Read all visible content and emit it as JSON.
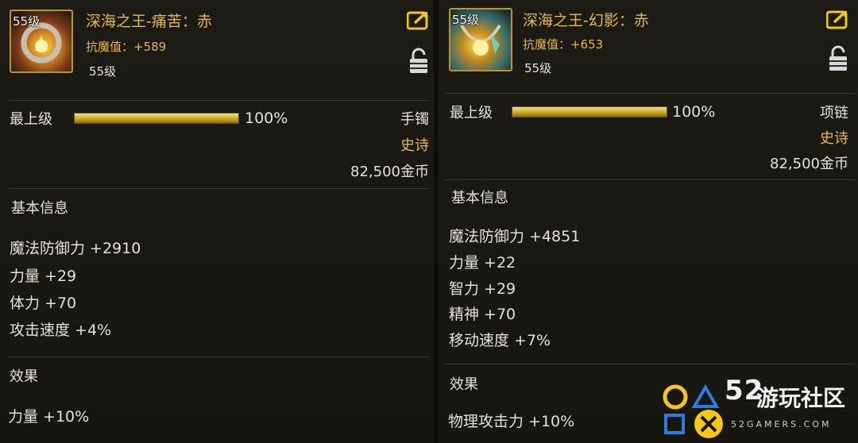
{
  "left": {
    "icon_level": "55级",
    "title": "深海之王-痛苦：赤",
    "resist": "抗魔值：+589",
    "level": "55级",
    "grade_label": "最上级",
    "grade_pct": "100%",
    "grade_fraction": 1.0,
    "slot": "手镯",
    "rarity": "史诗",
    "price": "82,500金币",
    "basic_header": "基本信息",
    "stats": [
      "魔法防御力 +2910",
      "力量 +29",
      "体力 +70",
      "攻击速度 +4%"
    ],
    "effect_header": "效果",
    "effects": [
      "力量 +10%"
    ]
  },
  "right": {
    "icon_level": "55级",
    "title": "深海之王-幻影：赤",
    "resist": "抗魔值：+653",
    "level": "55级",
    "grade_label": "最上级",
    "grade_pct": "100%",
    "grade_fraction": 1.0,
    "slot": "项链",
    "rarity": "史诗",
    "price": "82,500金币",
    "basic_header": "基本信息",
    "stats": [
      "魔法防御力 +4851",
      "力量 +22",
      "智力 +29",
      "精神 +70",
      "移动速度 +7%"
    ],
    "effect_header": "效果",
    "effects": [
      "物理攻击力 +10%"
    ]
  },
  "watermark": {
    "number": "52",
    "name": "游玩社区",
    "site": "52GAMERS.COM"
  },
  "colors": {
    "gold": "#e7b84a",
    "text": "#e6e1d8",
    "bar_fill": "#c8a31d",
    "logo_yellow": "#f5c518",
    "logo_blue": "#2a7de1"
  }
}
